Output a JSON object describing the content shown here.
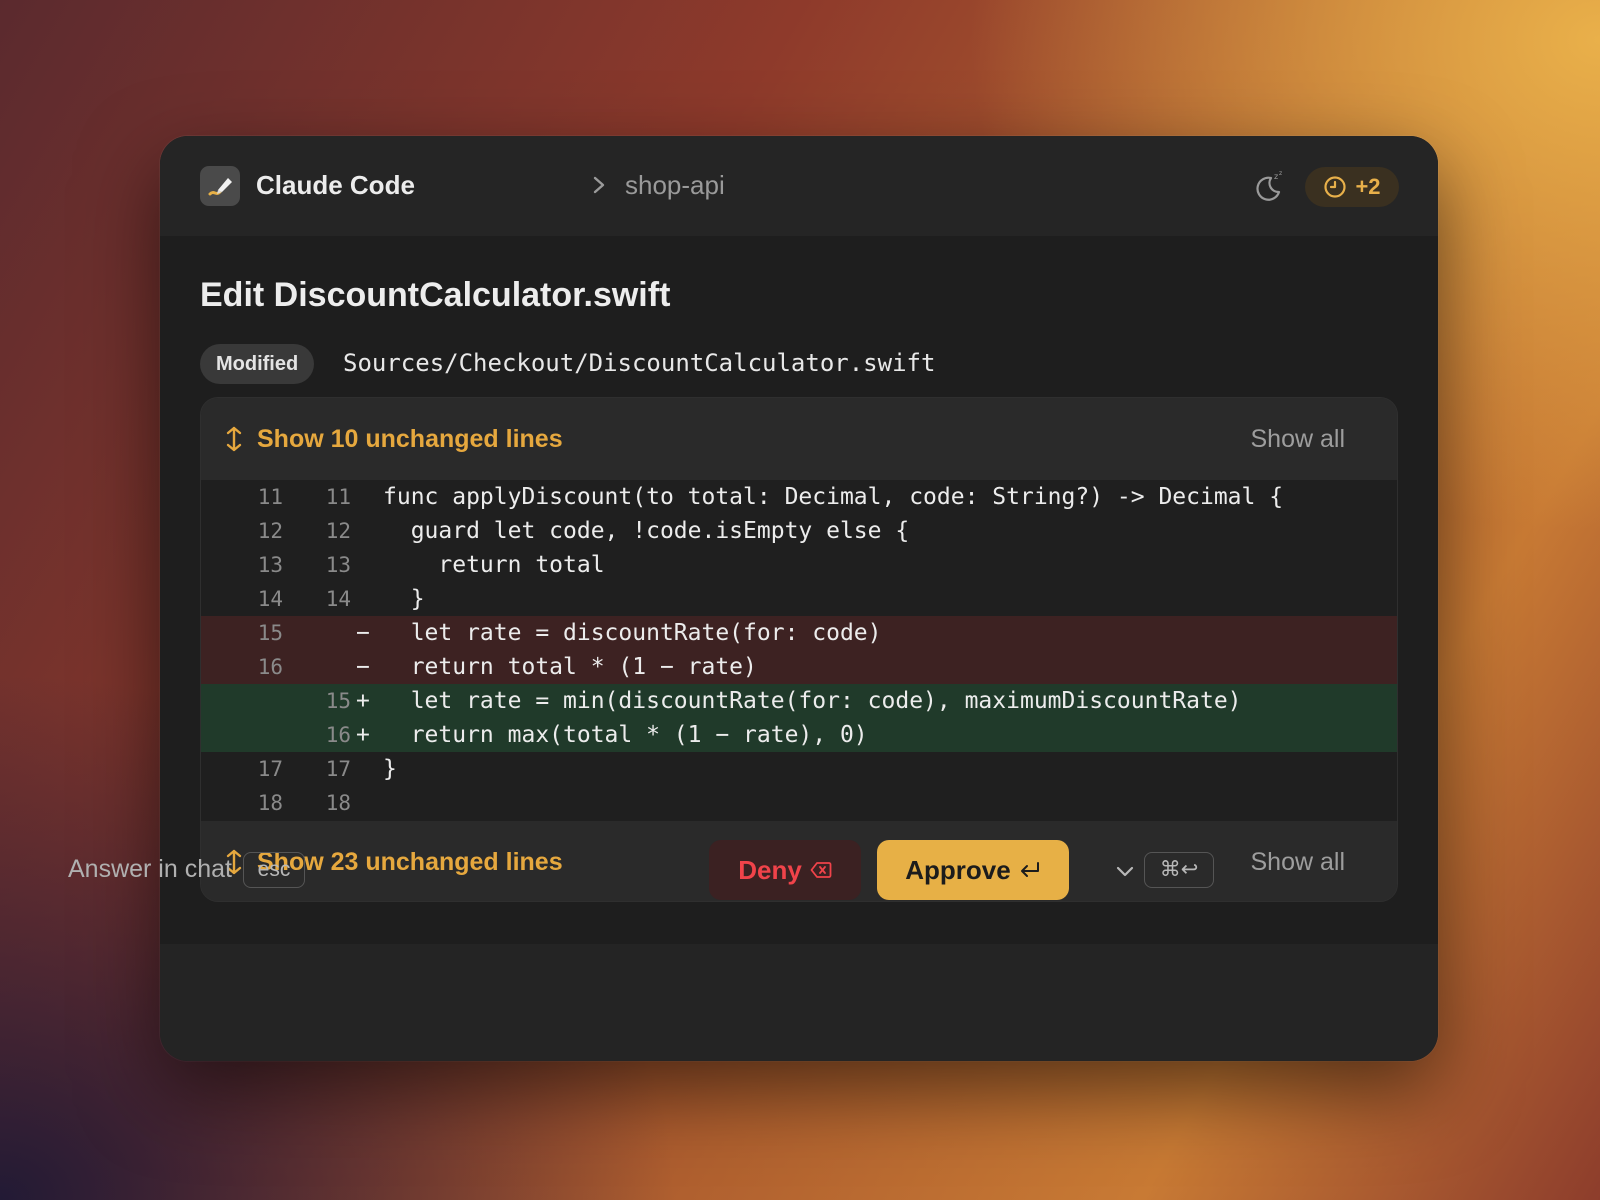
{
  "header": {
    "app_name": "Claude Code",
    "project": "shop-api",
    "queue_count": "+2"
  },
  "title": "Edit DiscountCalculator.swift",
  "file": {
    "status": "Modified",
    "path": "Sources/Checkout/DiscountCalculator.swift"
  },
  "diff": {
    "top_fold": {
      "label": "Show 10 unchanged lines",
      "action": "Show all"
    },
    "bottom_fold": {
      "label": "Show 23 unchanged lines",
      "action": "Show all"
    },
    "lines": [
      {
        "old": "11",
        "new": "11",
        "marker": "",
        "type": "context",
        "text": "func applyDiscount(to total: Decimal, code: String?) -> Decimal {"
      },
      {
        "old": "12",
        "new": "12",
        "marker": "",
        "type": "context",
        "text": "  guard let code, !code.isEmpty else {"
      },
      {
        "old": "13",
        "new": "13",
        "marker": "",
        "type": "context",
        "text": "    return total"
      },
      {
        "old": "14",
        "new": "14",
        "marker": "",
        "type": "context",
        "text": "  }"
      },
      {
        "old": "15",
        "new": "",
        "marker": "−",
        "type": "del",
        "text": "  let rate = discountRate(for: code)"
      },
      {
        "old": "16",
        "new": "",
        "marker": "−",
        "type": "del",
        "text": "  return total * (1 − rate)"
      },
      {
        "old": "",
        "new": "15",
        "marker": "+",
        "type": "add",
        "text": "  let rate = min(discountRate(for: code), maximumDiscountRate)"
      },
      {
        "old": "",
        "new": "16",
        "marker": "+",
        "type": "add",
        "text": "  return max(total * (1 − rate), 0)"
      },
      {
        "old": "17",
        "new": "17",
        "marker": "",
        "type": "context",
        "text": "}"
      },
      {
        "old": "18",
        "new": "18",
        "marker": "",
        "type": "context",
        "text": ""
      }
    ]
  },
  "footer": {
    "answer_label": "Answer in chat",
    "answer_key": "esc",
    "deny_label": "Deny",
    "approve_label": "Approve",
    "more_key": "⌘↩"
  },
  "colors": {
    "accent": "#e7b046",
    "deny": "#f0434a",
    "del_bg": "#3d2222",
    "add_bg": "#203a2a"
  },
  "icons": [
    "app-icon",
    "chevron-right-icon",
    "sleep-icon",
    "clock-icon",
    "expand-arrows-icon",
    "delete-key-icon",
    "return-key-icon",
    "chevron-down-icon"
  ]
}
